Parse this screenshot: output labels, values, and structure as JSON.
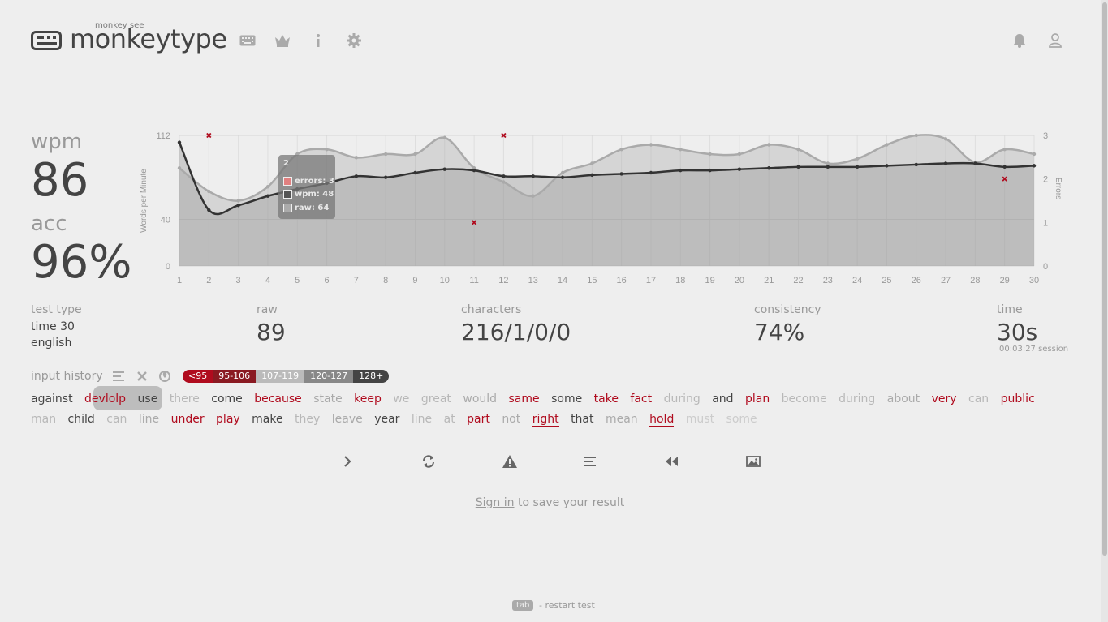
{
  "header": {
    "logo_small": "monkey see",
    "logo_text": "monkeytype",
    "nav_icons": [
      "keyboard-icon",
      "crown-icon",
      "info-icon",
      "gear-icon"
    ],
    "right_icons": [
      "bell-icon",
      "user-icon"
    ]
  },
  "result": {
    "wpm_label": "wpm",
    "wpm_value": "86",
    "acc_label": "acc",
    "acc_value": "96%"
  },
  "stats": {
    "test_type_label": "test type",
    "test_type_line1": "time 30",
    "test_type_line2": "english",
    "raw_label": "raw",
    "raw_value": "89",
    "characters_label": "characters",
    "characters_value": "216/1/0/0",
    "consistency_label": "consistency",
    "consistency_value": "74%",
    "time_label": "time",
    "time_value": "30s",
    "session_value": "00:03:27 session"
  },
  "input_history": {
    "title": "input history",
    "icons": [
      "lines-icon",
      "close-icon",
      "fire-icon"
    ],
    "legend": [
      {
        "label": "<95",
        "color": "#b00b1e"
      },
      {
        "label": "95-106",
        "color": "#8a1a22"
      },
      {
        "label": "107-119",
        "color": "#bbbbbb"
      },
      {
        "label": "120-127",
        "color": "#888888"
      },
      {
        "label": "128+",
        "color": "#444444"
      }
    ],
    "words": [
      {
        "t": "against",
        "s": "ok"
      },
      {
        "t": "devlolp",
        "s": "err"
      },
      {
        "t": "use",
        "s": "ok"
      },
      {
        "t": "there",
        "s": "faint"
      },
      {
        "t": "come",
        "s": "ok"
      },
      {
        "t": "because",
        "s": "err"
      },
      {
        "t": "state",
        "s": "dim"
      },
      {
        "t": "keep",
        "s": "err"
      },
      {
        "t": "we",
        "s": "faint"
      },
      {
        "t": "great",
        "s": "faint"
      },
      {
        "t": "would",
        "s": "dim"
      },
      {
        "t": "same",
        "s": "err"
      },
      {
        "t": "some",
        "s": "ok"
      },
      {
        "t": "take",
        "s": "err"
      },
      {
        "t": "fact",
        "s": "err"
      },
      {
        "t": "during",
        "s": "faint"
      },
      {
        "t": "and",
        "s": "ok"
      },
      {
        "t": "plan",
        "s": "err"
      },
      {
        "t": "become",
        "s": "faint"
      },
      {
        "t": "during",
        "s": "faint"
      },
      {
        "t": "about",
        "s": "dim"
      },
      {
        "t": "very",
        "s": "err"
      },
      {
        "t": "can",
        "s": "faint"
      },
      {
        "t": "public",
        "s": "err"
      },
      {
        "t": "man",
        "s": "faint"
      },
      {
        "t": "child",
        "s": "ok"
      },
      {
        "t": "can",
        "s": "faint"
      },
      {
        "t": "line",
        "s": "dim"
      },
      {
        "t": "under",
        "s": "err"
      },
      {
        "t": "play",
        "s": "err"
      },
      {
        "t": "make",
        "s": "ok"
      },
      {
        "t": "they",
        "s": "faint"
      },
      {
        "t": "leave",
        "s": "dim"
      },
      {
        "t": "year",
        "s": "ok"
      },
      {
        "t": "line",
        "s": "faint"
      },
      {
        "t": "at",
        "s": "faint"
      },
      {
        "t": "part",
        "s": "err"
      },
      {
        "t": "not",
        "s": "dim"
      },
      {
        "t": "right",
        "s": "err-u"
      },
      {
        "t": "that",
        "s": "ok"
      },
      {
        "t": "mean",
        "s": "dim"
      },
      {
        "t": "hold",
        "s": "err-u"
      },
      {
        "t": "must",
        "s": "vfaint"
      },
      {
        "t": "some",
        "s": "vfaint"
      }
    ]
  },
  "actions": [
    "next-test-icon",
    "restart-icon",
    "warning-icon",
    "word-list-icon",
    "replay-icon",
    "screenshot-icon"
  ],
  "signin": {
    "link": "Sign in",
    "rest": " to save your result"
  },
  "footer": {
    "key": "tab",
    "text": "- restart test"
  },
  "tooltip": {
    "title": "2",
    "errors": "errors: 3",
    "wpm": "wpm: 48",
    "raw": "raw: 64"
  },
  "chart_data": {
    "type": "line",
    "ylabel": "Words per Minute",
    "y2label": "Errors",
    "x": [
      1,
      2,
      3,
      4,
      5,
      6,
      7,
      8,
      9,
      10,
      11,
      12,
      13,
      14,
      15,
      16,
      17,
      18,
      19,
      20,
      21,
      22,
      23,
      24,
      25,
      26,
      27,
      28,
      29,
      30
    ],
    "ylim": [
      0,
      112
    ],
    "y2lim": [
      0,
      3
    ],
    "yticks": [
      "0",
      "40",
      "112"
    ],
    "y2ticks": [
      "0",
      "1",
      "2",
      "3"
    ],
    "series": [
      {
        "name": "wpm",
        "color": "#333333",
        "values": [
          106,
          48,
          52,
          60,
          66,
          71,
          77,
          76,
          80,
          83,
          82,
          77,
          77,
          76,
          78,
          79,
          80,
          82,
          82,
          83,
          84,
          85,
          85,
          85,
          86,
          87,
          88,
          88,
          85,
          86
        ]
      },
      {
        "name": "raw",
        "color": "#aaaaaa",
        "values": [
          84,
          64,
          56,
          68,
          96,
          100,
          93,
          96,
          96,
          110,
          84,
          72,
          60,
          80,
          88,
          100,
          104,
          100,
          96,
          96,
          104,
          100,
          88,
          92,
          104,
          112,
          109,
          89,
          100,
          96
        ]
      },
      {
        "name": "errors",
        "color": "#b00b1e",
        "type": "scatter",
        "points": [
          [
            2,
            3
          ],
          [
            11,
            1
          ],
          [
            12,
            3
          ],
          [
            29,
            2
          ]
        ]
      }
    ]
  }
}
